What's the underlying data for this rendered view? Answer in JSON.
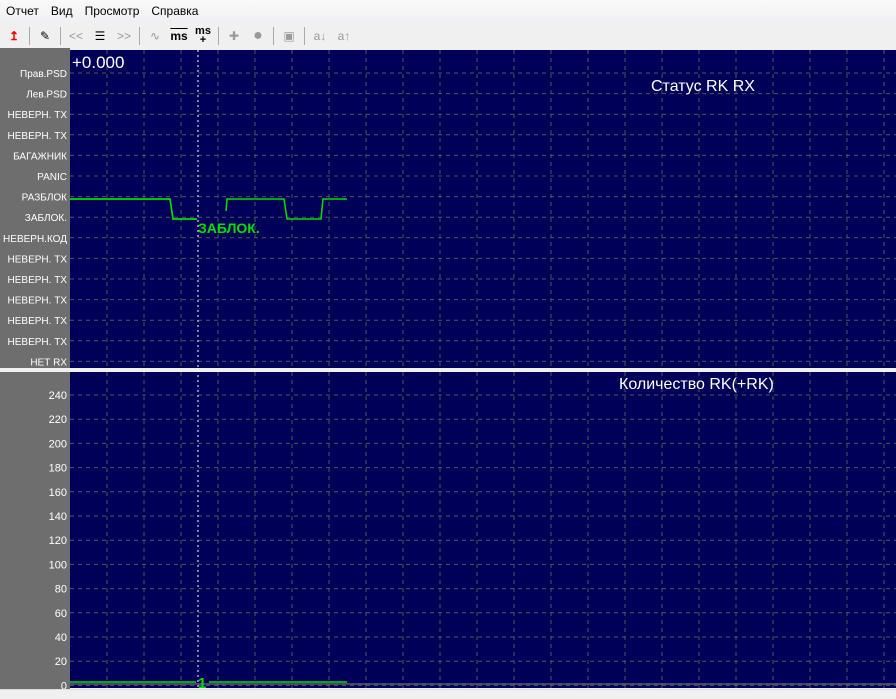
{
  "menu": [
    "Отчет",
    "Вид",
    "Просмотр",
    "Справка"
  ],
  "toolbar": {
    "ms_minus": "ms",
    "ms_plus_top": "ms",
    "ms_plus_bottom": "+",
    "a_down": "a↓",
    "a_up": "a↑",
    "prev": "<<",
    "next": ">>"
  },
  "top_panel": {
    "title": "Статус RK RX",
    "time_readout": "+0.000",
    "labels": [
      "Прав.PSD",
      "Лев.PSD",
      "НЕВЕРН. TX",
      "НЕВЕРН. TX",
      "БАГАЖНИК",
      "PANIC",
      "РАЗБЛОК",
      "ЗАБЛОК.",
      "НЕВЕРН.КОД",
      "НЕВЕРН. TX",
      "НЕВЕРН. TX",
      "НЕВЕРН. TX",
      "НЕВЕРН. TX",
      "НЕВЕРН. TX",
      "НЕТ RX"
    ],
    "cursor_value": "ЗАБЛОК."
  },
  "bottom_panel": {
    "title": "Количество RK(+RK)",
    "ticks": [
      "240",
      "220",
      "200",
      "180",
      "160",
      "140",
      "120",
      "100",
      "80",
      "60",
      "40",
      "20",
      "0"
    ],
    "cursor_value": "1"
  },
  "colors": {
    "plot_bg": "#000058",
    "trace": "#00e000",
    "label_bg": "#6e6e6e"
  }
}
